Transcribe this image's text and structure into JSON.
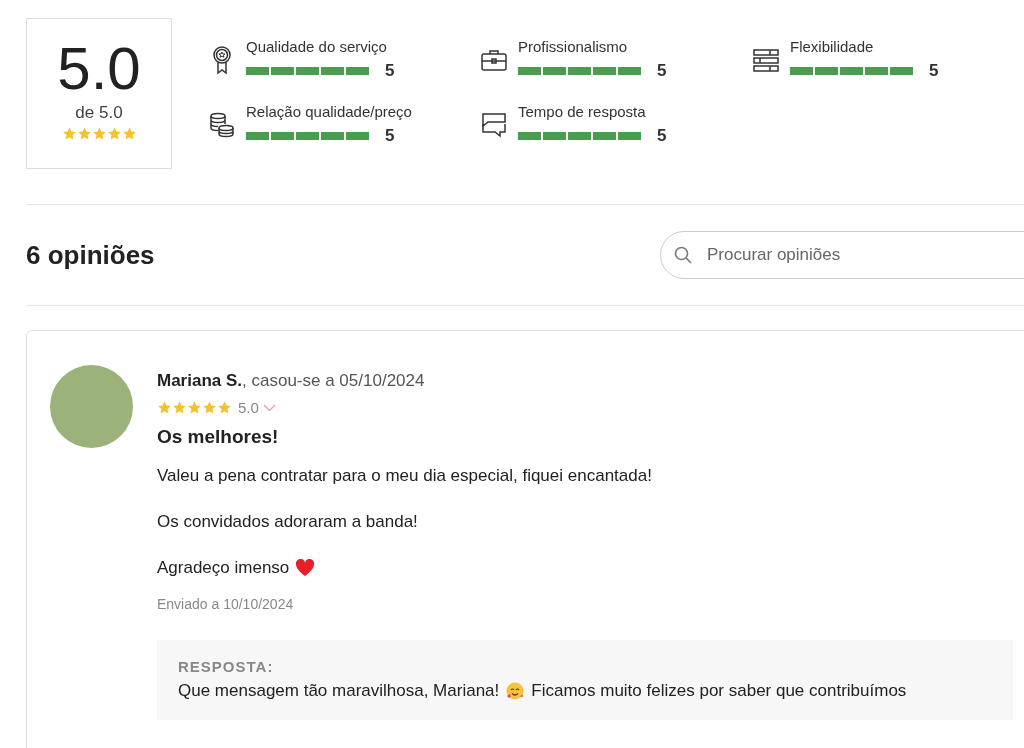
{
  "summary": {
    "score": "5.0",
    "out_of": "de 5.0",
    "stars": 5
  },
  "categories": [
    {
      "kind": "award",
      "label": "Qualidade do serviço",
      "level": 1,
      "score": "5"
    },
    {
      "kind": "briefcase",
      "label": "Profissionalismo",
      "level": 1,
      "score": "5"
    },
    {
      "kind": "layers",
      "label": "Flexibilidade",
      "level": 1,
      "score": "5"
    },
    {
      "kind": "coins",
      "label": "Relação qualidade/preço",
      "level": 1,
      "score": "5"
    },
    {
      "kind": "chat",
      "label": "Tempo de resposta",
      "level": 1,
      "score": "5"
    }
  ],
  "reviews_heading": "6 opiniões",
  "search": {
    "placeholder": "Procurar opiniões"
  },
  "reviews": [
    {
      "author": "Mariana S.",
      "meta": ", casou-se a 05/10/2024",
      "stars": 5,
      "rating": "5.0",
      "title": "Os melhores!",
      "paragraphs": [
        "Valeu a pena contratar para o meu dia especial, fiquei encantada!",
        "Os convidados adoraram a banda!",
        "Agradeço imenso"
      ],
      "sent": "Enviado a 10/10/2024",
      "reply": {
        "label": "RESPOSTA:",
        "text_before": "Que mensagem tão maravilhosa, Mariana!",
        "text_after": "Ficamos muito felizes por saber que contribuímos"
      }
    }
  ]
}
